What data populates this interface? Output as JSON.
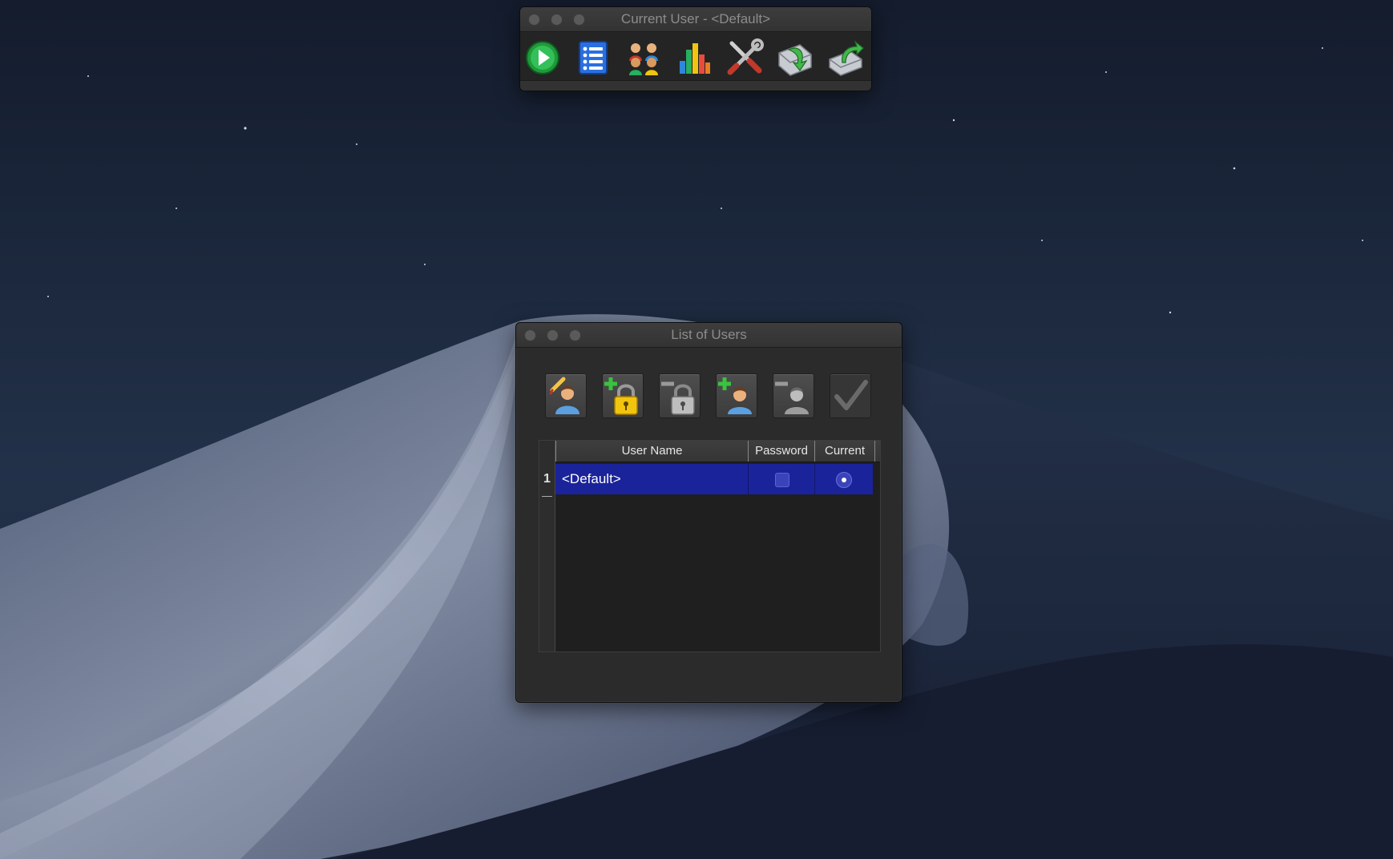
{
  "toolbar_window": {
    "title": "Current User - <Default>",
    "buttons": [
      {
        "name": "play-icon"
      },
      {
        "name": "list-icon"
      },
      {
        "name": "users-group-icon"
      },
      {
        "name": "bar-chart-icon"
      },
      {
        "name": "tools-icon"
      },
      {
        "name": "import-icon"
      },
      {
        "name": "export-icon"
      }
    ]
  },
  "users_window": {
    "title": "List of Users",
    "buttons": [
      {
        "name": "edit-user-icon",
        "enabled": true
      },
      {
        "name": "add-password-icon",
        "enabled": true
      },
      {
        "name": "remove-password-icon",
        "enabled": true
      },
      {
        "name": "add-user-icon",
        "enabled": true
      },
      {
        "name": "remove-user-icon",
        "enabled": true
      },
      {
        "name": "checkmark-icon",
        "enabled": false
      }
    ],
    "table": {
      "columns": [
        "User Name",
        "Password",
        "Current"
      ],
      "rows": [
        {
          "index": "1",
          "user_name": "<Default>",
          "password": false,
          "current": true,
          "selected": true
        }
      ]
    }
  },
  "colors": {
    "selection": "#1a2399",
    "window_bg": "#2b2b2b",
    "desktop": "#182238"
  }
}
